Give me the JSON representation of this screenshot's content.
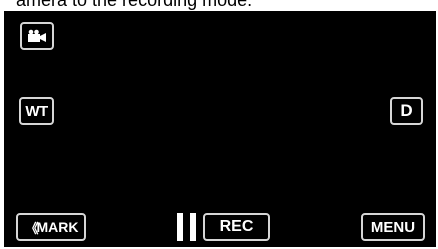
{
  "caption": {
    "text": "amera to the recording mode."
  },
  "mode_button": {
    "icon": "video-camera-icon"
  },
  "zoom_button": {
    "label": "WT"
  },
  "display_button": {
    "label": "D"
  },
  "mark_button": {
    "chevron": "《",
    "label": "MARK"
  },
  "pause_icon": {
    "icon": "pause-icon"
  },
  "rec_button": {
    "label": "REC"
  },
  "menu_button": {
    "label": "MENU"
  }
}
